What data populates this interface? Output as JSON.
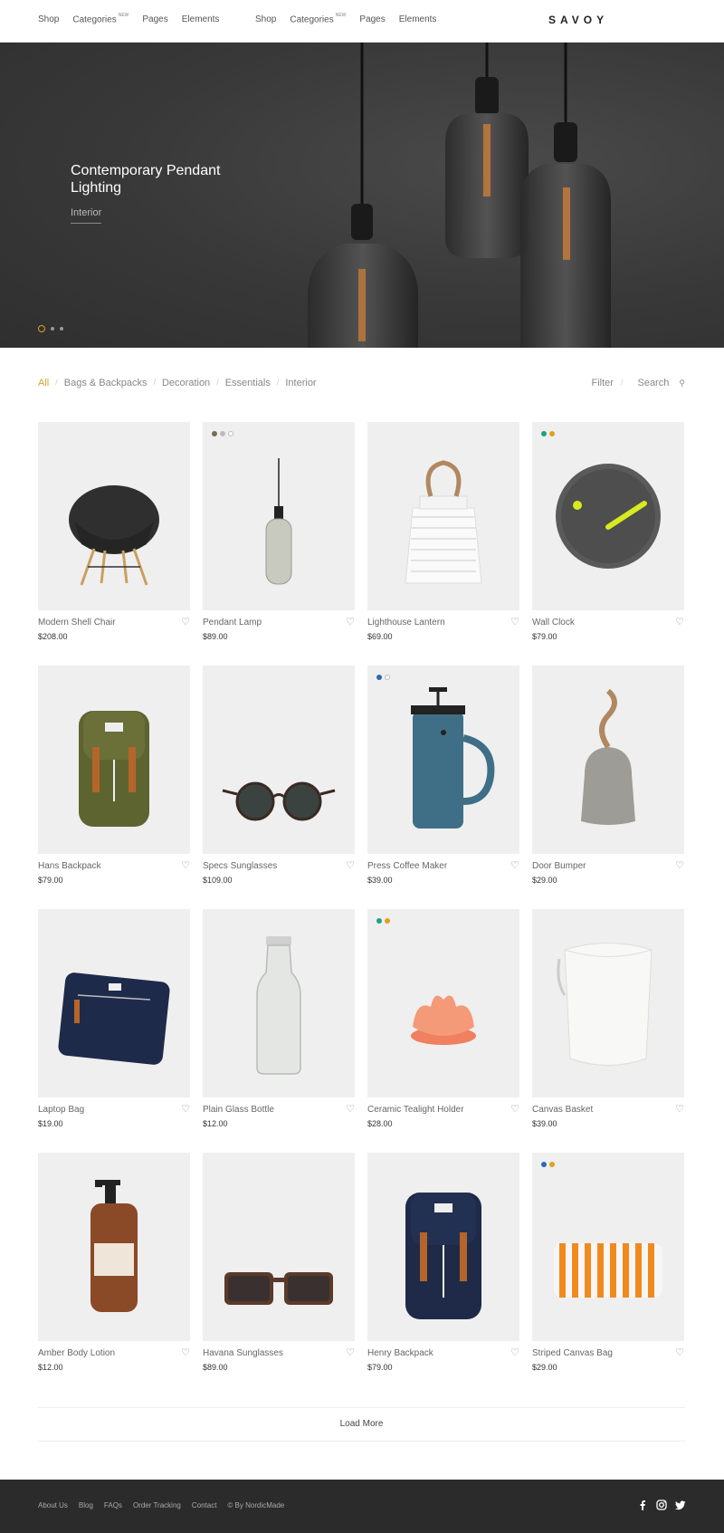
{
  "header": {
    "nav_left": [
      {
        "label": "Shop"
      },
      {
        "label": "Categories",
        "badge": "NEW"
      },
      {
        "label": "Pages"
      },
      {
        "label": "Elements"
      }
    ],
    "nav_mid": [
      {
        "label": "Shop"
      },
      {
        "label": "Categories",
        "badge": "NEW"
      },
      {
        "label": "Pages"
      },
      {
        "label": "Elements"
      }
    ],
    "logo": "SAVOY"
  },
  "hero": {
    "title": "Contemporary Pendant Lighting",
    "category": "Interior",
    "slide_count": 3,
    "active_slide": 1,
    "accent_color": "#e0a020"
  },
  "filters": {
    "categories": [
      "All",
      "Bags & Backpacks",
      "Decoration",
      "Essentials",
      "Interior"
    ],
    "active": "All",
    "filter_label": "Filter",
    "search_label": "Search",
    "active_color": "#d4a030"
  },
  "products": [
    {
      "name": "Modern Shell Chair",
      "price": "$208.00",
      "icon": "chair",
      "swatches": []
    },
    {
      "name": "Pendant Lamp",
      "price": "$89.00",
      "icon": "pendant-lamp",
      "swatches": [
        "#7a6a5a",
        "#bbbbbb",
        "#ffffff"
      ]
    },
    {
      "name": "Lighthouse Lantern",
      "price": "$69.00",
      "icon": "lantern",
      "swatches": []
    },
    {
      "name": "Wall Clock",
      "price": "$79.00",
      "icon": "clock",
      "swatches": [
        "#1aa38a",
        "#e0a020"
      ]
    },
    {
      "name": "Hans Backpack",
      "price": "$79.00",
      "icon": "backpack-olive",
      "swatches": []
    },
    {
      "name": "Specs Sunglasses",
      "price": "$109.00",
      "icon": "sunglasses-round",
      "swatches": []
    },
    {
      "name": "Press Coffee Maker",
      "price": "$39.00",
      "icon": "coffee-press",
      "swatches": [
        "#2a6bb5",
        "#ffffff"
      ]
    },
    {
      "name": "Door Bumper",
      "price": "$29.00",
      "icon": "door-bumper",
      "swatches": []
    },
    {
      "name": "Laptop Bag",
      "price": "$19.00",
      "icon": "laptop-bag",
      "swatches": []
    },
    {
      "name": "Plain Glass Bottle",
      "price": "$12.00",
      "icon": "glass-bottle",
      "swatches": []
    },
    {
      "name": "Ceramic Tealight Holder",
      "price": "$28.00",
      "icon": "tealight",
      "swatches": [
        "#1aa38a",
        "#e0a020"
      ]
    },
    {
      "name": "Canvas Basket",
      "price": "$39.00",
      "icon": "canvas-basket",
      "swatches": []
    },
    {
      "name": "Amber Body Lotion",
      "price": "$12.00",
      "icon": "lotion",
      "swatches": []
    },
    {
      "name": "Havana Sunglasses",
      "price": "$89.00",
      "icon": "sunglasses-square",
      "swatches": []
    },
    {
      "name": "Henry Backpack",
      "price": "$79.00",
      "icon": "backpack-navy",
      "swatches": []
    },
    {
      "name": "Striped Canvas Bag",
      "price": "$29.00",
      "icon": "striped-bag",
      "swatches": [
        "#2a6bb5",
        "#e0a020"
      ]
    }
  ],
  "load_more": "Load More",
  "footer": {
    "links": [
      "About Us",
      "Blog",
      "FAQs",
      "Order Tracking",
      "Contact",
      "© By NordicMade"
    ],
    "social": [
      "facebook-icon",
      "instagram-icon",
      "twitter-icon"
    ]
  }
}
